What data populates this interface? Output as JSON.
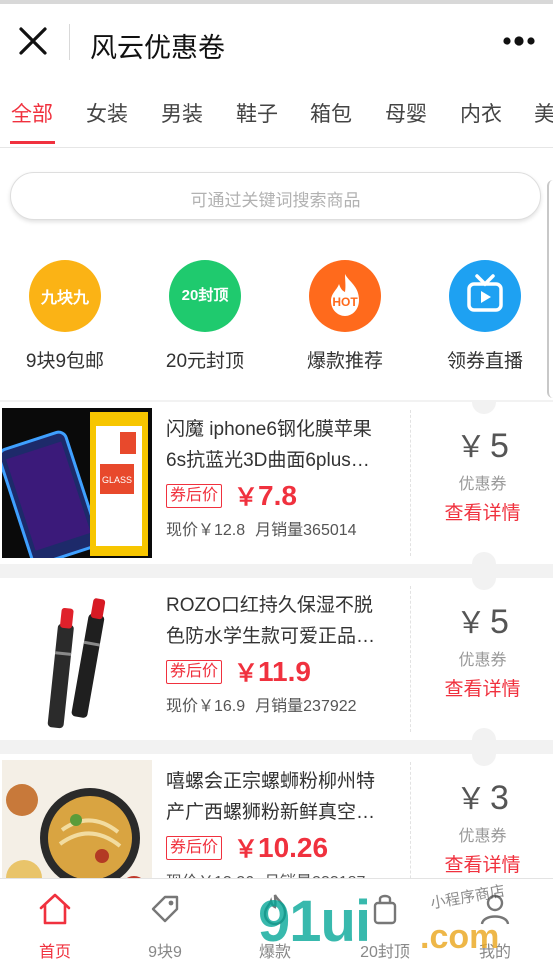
{
  "header": {
    "title": "风云优惠卷",
    "close_icon": "close-icon",
    "more_icon": "more-dots-icon"
  },
  "tabs": [
    {
      "label": "全部",
      "active": true
    },
    {
      "label": "女装"
    },
    {
      "label": "男装"
    },
    {
      "label": "鞋子"
    },
    {
      "label": "箱包"
    },
    {
      "label": "母婴"
    },
    {
      "label": "内衣"
    },
    {
      "label": "美"
    }
  ],
  "search": {
    "placeholder": "可通过关键词搜索商品"
  },
  "categories": [
    {
      "icon_text": "九块九",
      "label": "9块9包邮",
      "color": "#fbb315"
    },
    {
      "icon_text": "20封顶",
      "label": "20元封顶",
      "color": "#1fca6e"
    },
    {
      "icon_text": "HOT",
      "label": "爆款推荐",
      "color": "#ff6a1c"
    },
    {
      "icon_text": "tv-icon",
      "label": "领券直播",
      "color": "#1ea1f2"
    }
  ],
  "products": [
    {
      "name_line1": "闪魔 iphone6钢化膜苹果",
      "name_line2": "6s抗蓝光3D曲面6plus…",
      "coupon_tag": "券后价",
      "currency": "￥",
      "price": "7.8",
      "orig_price": "现价￥12.8",
      "sales": "月销量365014",
      "coupon_value": "5",
      "coupon_caption": "优惠券",
      "detail_label": "查看详情"
    },
    {
      "name_line1": "ROZO口红持久保湿不脱",
      "name_line2": "色防水学生款可爱正品…",
      "coupon_tag": "券后价",
      "currency": "￥",
      "price": "11.9",
      "orig_price": "现价￥16.9",
      "sales": "月销量237922",
      "coupon_value": "5",
      "coupon_caption": "优惠券",
      "detail_label": "查看详情"
    },
    {
      "name_line1": "嘻螺会正宗螺蛳粉柳州特",
      "name_line2": "产广西螺狮粉新鲜真空…",
      "coupon_tag": "券后价",
      "currency": "￥",
      "price": "10.26",
      "orig_price": "现价￥13.26",
      "sales": "月销量233187",
      "coupon_value": "3",
      "coupon_caption": "优惠券",
      "detail_label": "查看详情"
    }
  ],
  "bottom_nav": [
    {
      "label": "首页",
      "icon": "home-icon",
      "active": true
    },
    {
      "label": "9块9",
      "icon": "tag-icon"
    },
    {
      "label": "爆款",
      "icon": "flame-icon"
    },
    {
      "label": "20封顶",
      "icon": "bag-icon"
    },
    {
      "label": "我的",
      "icon": "user-icon"
    }
  ],
  "watermark": {
    "main": "91ui",
    "suffix": ".com",
    "handwriting": "小程序商店"
  },
  "colors": {
    "accent": "#f0313e",
    "background": "#f2f2f2"
  }
}
